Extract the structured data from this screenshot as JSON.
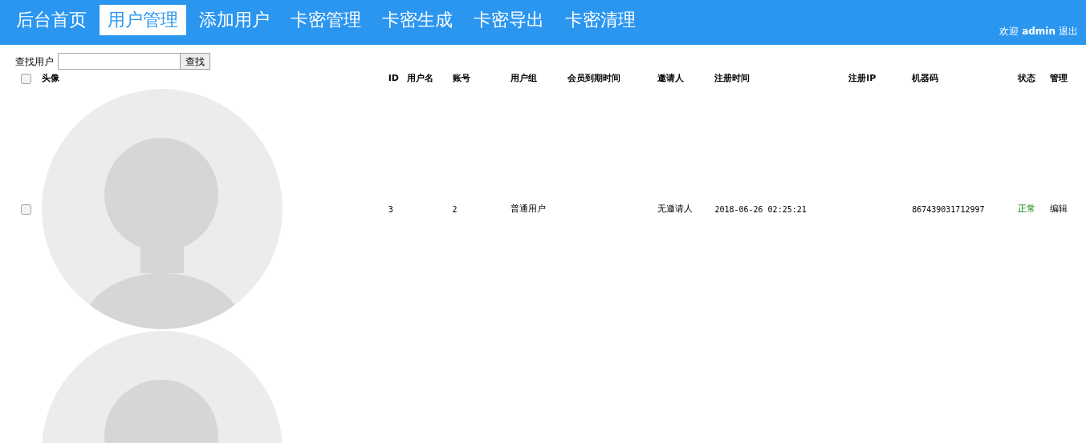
{
  "nav": [
    {
      "label": "后台首页",
      "selected": false
    },
    {
      "label": "用户管理",
      "selected": true
    },
    {
      "label": "添加用户",
      "selected": false
    },
    {
      "label": "卡密管理",
      "selected": false
    },
    {
      "label": "卡密生成",
      "selected": false
    },
    {
      "label": "卡密导出",
      "selected": false
    },
    {
      "label": "卡密清理",
      "selected": false
    }
  ],
  "welcome": {
    "prefix": "欢迎",
    "user": "admin",
    "logout": "退出"
  },
  "search": {
    "label": "查找用户",
    "button": "查找"
  },
  "table": {
    "header_checked": false,
    "columns": [
      "头像",
      "ID",
      "用户名",
      "账号",
      "用户组",
      "会员到期时间",
      "邀请人",
      "注册时间",
      "注册IP",
      "机器码",
      "状态",
      "管理"
    ],
    "rows": [
      {
        "kind": "full",
        "checked": false,
        "id": "3",
        "username": "",
        "account": "2",
        "group": "普通用户",
        "expiry": "",
        "inviter": "无邀请人",
        "registered": "2018-06-26 02:25:21",
        "ip": "",
        "machine": "867439031712997",
        "status": "正常",
        "action": "编辑"
      },
      {
        "kind": "cut"
      }
    ]
  }
}
